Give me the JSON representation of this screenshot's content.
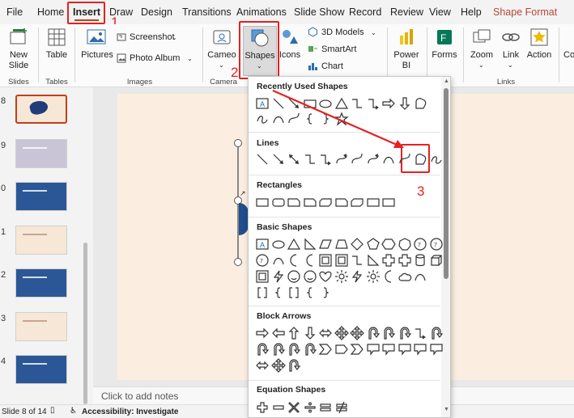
{
  "tabs": {
    "file": "File",
    "home": "Home",
    "insert": "Insert",
    "draw": "Draw",
    "design": "Design",
    "transitions": "Transitions",
    "animations": "Animations",
    "slideshow": "Slide Show",
    "record": "Record",
    "review": "Review",
    "view": "View",
    "help": "Help",
    "shape_format": "Shape Format"
  },
  "ribbon": {
    "new_slide": "New Slide",
    "table": "Table",
    "pictures": "Pictures",
    "screenshot": "Screenshot",
    "photo_album": "Photo Album",
    "cameo": "Cameo",
    "shapes": "Shapes",
    "icons": "Icons",
    "models3d": "3D Models",
    "smartart": "SmartArt",
    "chart": "Chart",
    "powerbi": "Power BI",
    "forms": "Forms",
    "zoom": "Zoom",
    "link": "Link",
    "action": "Action",
    "comment": "Co",
    "groups": {
      "slides": "Slides",
      "tables": "Tables",
      "images": "Images",
      "camera": "Camera",
      "links": "Links"
    }
  },
  "thumbnails": [
    {
      "num": "8",
      "bg": "#f7e7d6",
      "selected": true
    },
    {
      "num": "9",
      "bg": "#c9c5d6",
      "selected": false
    },
    {
      "num": "0",
      "bg": "#2b5797",
      "selected": false
    },
    {
      "num": "1",
      "bg": "#f7e7d6",
      "selected": false
    },
    {
      "num": "2",
      "bg": "#2b5797",
      "selected": false
    },
    {
      "num": "3",
      "bg": "#f7e7d6",
      "selected": false
    },
    {
      "num": "4",
      "bg": "#2b5797",
      "selected": false
    }
  ],
  "dropdown": {
    "recent": "Recently Used Shapes",
    "lines": "Lines",
    "rectangles": "Rectangles",
    "basic": "Basic Shapes",
    "block_arrows": "Block Arrows",
    "equation": "Equation Shapes"
  },
  "notes": {
    "placeholder": "Click to add notes"
  },
  "status": {
    "slide_info": "Slide 8 of 14",
    "accessibility": "Accessibility: Investigate"
  },
  "annotations": {
    "step1": "1",
    "step2": "2",
    "step3": "3"
  },
  "colors": {
    "annotation": "#e32222",
    "shape_format": "#c0504d",
    "insert_underline": "#c43e1c"
  }
}
